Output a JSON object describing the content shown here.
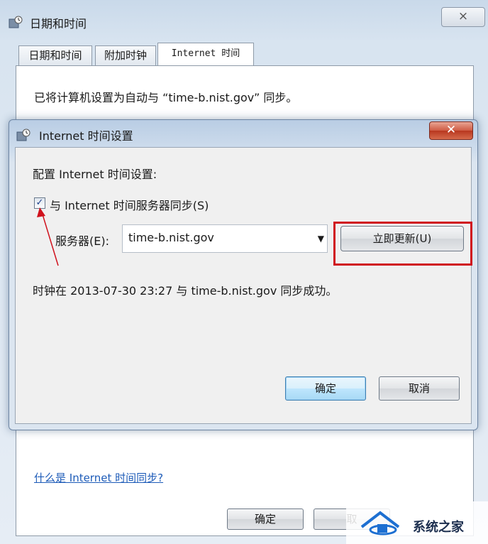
{
  "outer": {
    "title": "日期和时间",
    "close_label": "⨯",
    "tabs": [
      "日期和时间",
      "附加时钟",
      "Internet 时间"
    ],
    "sync_text": "已将计算机设置为自动与 “time-b.nist.gov” 同步。",
    "help_link": "什么是 Internet 时间同步?",
    "ok_label": "确定",
    "cancel_label_partial": "取"
  },
  "inner": {
    "title": "Internet 时间设置",
    "close_label": "✕",
    "config_label": "配置 Internet 时间设置:",
    "checkbox_label": "与 Internet 时间服务器同步(S)",
    "checkbox_checked": true,
    "server_label": "服务器(E):",
    "server_value": "time-b.nist.gov",
    "update_now_label": "立即更新(U)",
    "status_text": "时钟在 2013-07-30 23:27 与 time-b.nist.gov 同步成功。",
    "ok_label": "确定",
    "cancel_label": "取消"
  },
  "watermark": {
    "text": "系统之家"
  },
  "colors": {
    "highlight": "#d0121d",
    "link": "#1d5bb8",
    "arrow": "#d0121d"
  },
  "icons": [
    "clock-globe-icon",
    "close-icon",
    "chevron-down-icon"
  ]
}
